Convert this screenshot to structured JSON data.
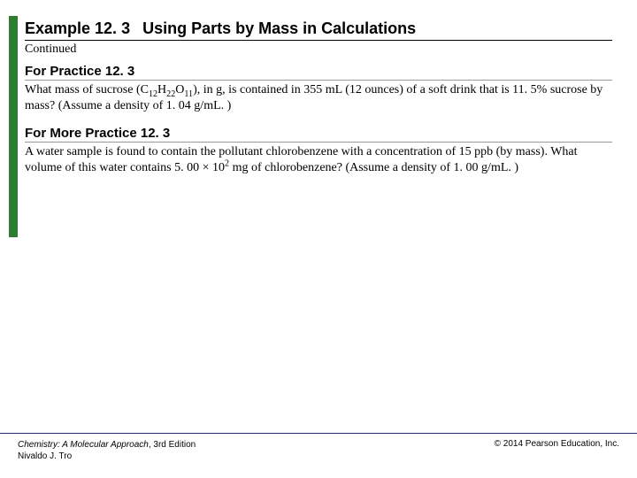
{
  "header": {
    "example_label": "Example 12. 3",
    "title": "Using Parts by Mass in Calculations",
    "continued": "Continued"
  },
  "practice": {
    "heading": "For Practice 12. 3",
    "text_pre": "What mass of sucrose (C",
    "sub1": "12",
    "mid1": "H",
    "sub2": "22",
    "mid2": "O",
    "sub3": "11",
    "text_post": "), in g, is contained in 355 mL (12 ounces) of a soft drink that is 11. 5% sucrose by mass? (Assume a density of 1. 04 g/mL. )"
  },
  "more": {
    "heading": "For More Practice 12. 3",
    "text_pre": "A water sample is found to contain the pollutant chlorobenzene with a concentration of 15 ppb (by mass). What volume of this water contains 5. 00 × 10",
    "sup": "2",
    "text_post": " mg of chlorobenzene? (Assume a density of 1. 00 g/mL. )"
  },
  "footer": {
    "book_title": "Chemistry: A Molecular Approach",
    "edition": ", 3rd Edition",
    "author": "Nivaldo J. Tro",
    "copyright": "© 2014 Pearson Education, Inc."
  }
}
